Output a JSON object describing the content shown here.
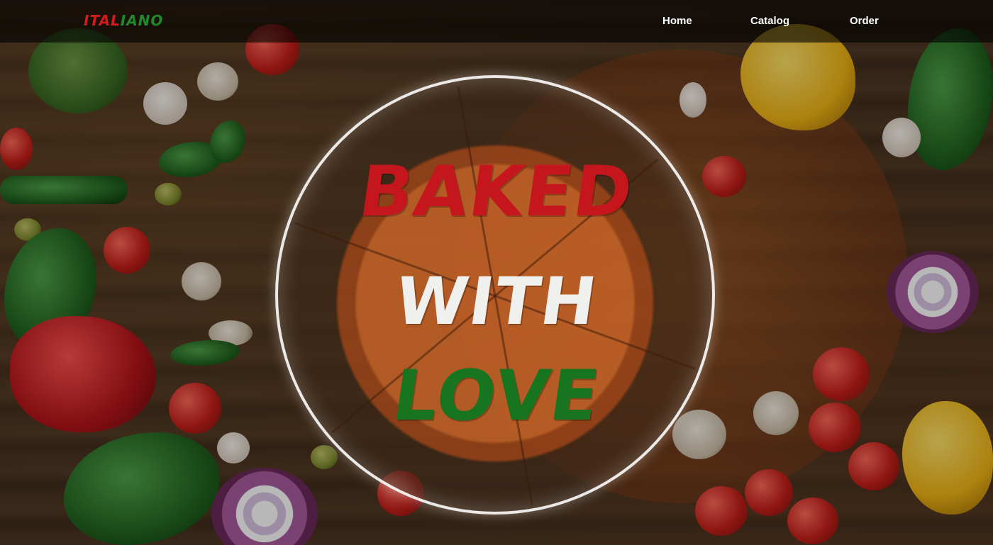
{
  "header": {
    "logo": {
      "part1": "Ital",
      "part2": "iano"
    },
    "nav": [
      {
        "label": "Home"
      },
      {
        "label": "Catalog"
      },
      {
        "label": "Order"
      }
    ]
  },
  "hero": {
    "line1": "Baked",
    "line2": "With",
    "line3": "Love"
  },
  "colors": {
    "red": "#c4161c",
    "white": "#f0f0ee",
    "green": "#17751f",
    "nav_background": "rgba(0,0,0,0.6)"
  }
}
